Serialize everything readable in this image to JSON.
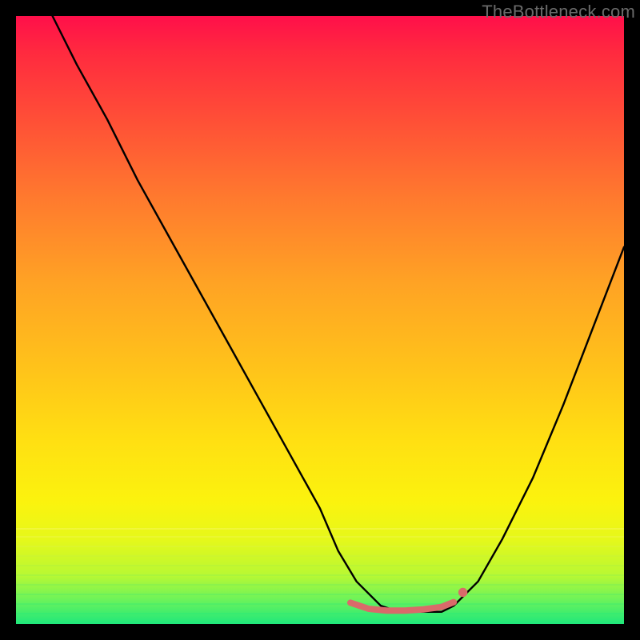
{
  "attribution": "TheBottleneck.com",
  "colors": {
    "background": "#000000",
    "curve_stroke": "#000000",
    "accent_stroke": "#d96a6a",
    "gradient_top": "#ff0f4a",
    "gradient_bottom": "#1fe87b"
  },
  "chart_data": {
    "type": "line",
    "title": "",
    "xlabel": "",
    "ylabel": "",
    "xlim": [
      0,
      100
    ],
    "ylim": [
      0,
      100
    ],
    "grid": false,
    "legend": false,
    "note": "Axis values are estimated from pixel positions; the image shows no numeric tick labels. y is read as distance from the bottom of the gradient area (0 = bottom/green, 100 = top/red).",
    "series": [
      {
        "name": "bottleneck-curve",
        "x": [
          6,
          10,
          15,
          20,
          25,
          30,
          35,
          40,
          45,
          50,
          53,
          56,
          60,
          63,
          66,
          70,
          72,
          76,
          80,
          85,
          90,
          95,
          100
        ],
        "y": [
          100,
          92,
          83,
          73,
          64,
          55,
          46,
          37,
          28,
          19,
          12,
          7,
          3,
          2,
          2,
          2,
          3,
          7,
          14,
          24,
          36,
          49,
          62
        ]
      },
      {
        "name": "highlight-flat-segment",
        "x": [
          55,
          58,
          61,
          64,
          67,
          70,
          72
        ],
        "y": [
          3.5,
          2.5,
          2.2,
          2.2,
          2.4,
          2.8,
          3.6
        ]
      }
    ],
    "markers": [
      {
        "name": "highlight-end-dot",
        "x": 73.5,
        "y": 5.2
      }
    ]
  }
}
